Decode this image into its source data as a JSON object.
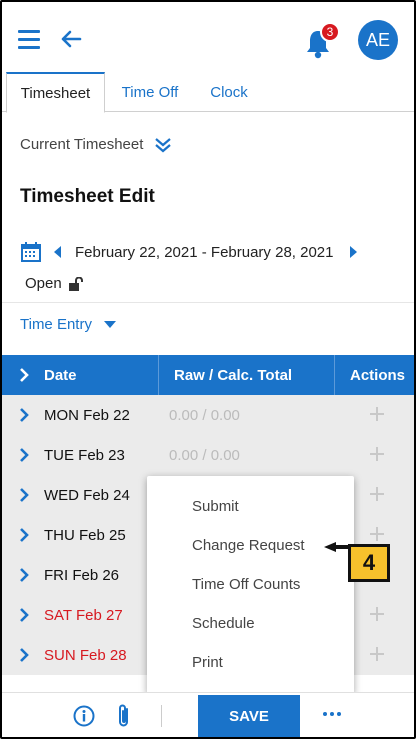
{
  "header": {
    "notification_count": "3",
    "avatar_initials": "AE"
  },
  "tabs": [
    {
      "label": "Timesheet",
      "active": true
    },
    {
      "label": "Time Off",
      "active": false
    },
    {
      "label": "Clock",
      "active": false
    }
  ],
  "current_timesheet_label": "Current Timesheet",
  "page_title": "Timesheet Edit",
  "date_range": "February 22, 2021 - February 28, 2021",
  "status": "Open",
  "time_entry_label": "Time Entry",
  "table": {
    "headers": {
      "date": "Date",
      "total": "Raw / Calc. Total",
      "actions": "Actions"
    },
    "rows": [
      {
        "date": "MON Feb 22",
        "total": "0.00 / 0.00",
        "weekend": false
      },
      {
        "date": "TUE Feb 23",
        "total": "0.00 / 0.00",
        "weekend": false
      },
      {
        "date": "WED Feb 24",
        "total": "",
        "weekend": false
      },
      {
        "date": "THU Feb 25",
        "total": "",
        "weekend": false
      },
      {
        "date": "FRI Feb 26",
        "total": "",
        "weekend": false
      },
      {
        "date": "SAT Feb 27",
        "total": "",
        "weekend": true
      },
      {
        "date": "SUN Feb 28",
        "total": "",
        "weekend": true
      }
    ]
  },
  "menu": {
    "items": [
      "Submit",
      "Change Request",
      "Time Off Counts",
      "Schedule",
      "Print"
    ]
  },
  "callout_number": "4",
  "footer": {
    "save_label": "SAVE"
  },
  "colors": {
    "accent": "#1a73c9",
    "weekend": "#d71920",
    "row_bg": "#ebebeb",
    "callout": "#f6c12c"
  }
}
